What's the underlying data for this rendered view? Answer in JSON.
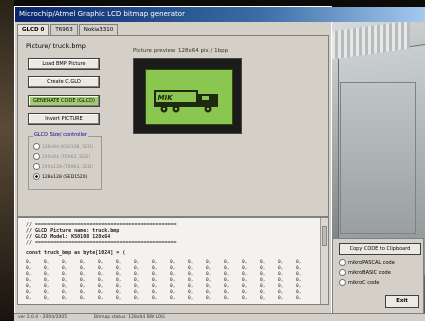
{
  "window": {
    "title": "Microchip/Atmel Graphic LCD bitmap generator"
  },
  "tabs": [
    {
      "label": "GLCD 0",
      "active": true
    },
    {
      "label": "T6963",
      "active": false
    },
    {
      "label": "Nokia3310",
      "active": false
    }
  ],
  "panel": {
    "section_title": "Picture/ truck.bmp",
    "buttons": [
      {
        "label": "Load BMP Picture",
        "style": "normal"
      },
      {
        "label": "Create C.GLD",
        "style": "normal"
      },
      {
        "label": "GENERATE CODE (GLCD)",
        "style": "green"
      },
      {
        "label": "Invert PICTURE",
        "style": "normal"
      }
    ],
    "controller": {
      "legend": "GLCD Size/ controller",
      "options": [
        {
          "label": "128x64 (KS0108, SED)",
          "selected": false
        },
        {
          "label": "240x64 (T6963, SED)",
          "selected": false
        },
        {
          "label": "240x128 (T6963, SED)",
          "selected": false
        },
        {
          "label": "128x128 (SED1520)",
          "selected": true
        }
      ]
    },
    "preview": {
      "label": "Picture preview",
      "resolution": "128x64 pix / 1bpp"
    }
  },
  "code": {
    "header_lines": [
      "// ===============================================",
      "// GLCD Picture name: truck.bmp",
      "// GLCD Model: KS0108 128x64",
      "// ==============================================="
    ],
    "array_decl": "const truck_bmp as byte[1024] = (",
    "rows": [
      [
        "0,",
        "0,",
        "0,",
        "0,",
        "0,",
        "0,",
        "0,",
        "0,",
        "0,",
        "0,",
        "0,",
        "0,",
        "0,",
        "0,",
        "0,",
        "0,"
      ],
      [
        "0,",
        "0,",
        "0,",
        "0,",
        "0,",
        "0,",
        "0,",
        "0,",
        "0,",
        "0,",
        "0,",
        "0,",
        "0,",
        "0,",
        "0,",
        "0,"
      ],
      [
        "0,",
        "0,",
        "0,",
        "0,",
        "0,",
        "0,",
        "0,",
        "0,",
        "0,",
        "0,",
        "0,",
        "0,",
        "0,",
        "0,",
        "0,",
        "0,"
      ],
      [
        "0,",
        "0,",
        "0,",
        "0,",
        "0,",
        "0,",
        "0,",
        "0,",
        "0,",
        "0,",
        "0,",
        "0,",
        "0,",
        "0,",
        "0,",
        "0,"
      ],
      [
        "0,",
        "0,",
        "0,",
        "0,",
        "0,",
        "0,",
        "0,",
        "0,",
        "0,",
        "0,",
        "0,",
        "0,",
        "0,",
        "0,",
        "0,",
        "0,"
      ],
      [
        "0,",
        "0,",
        "0,",
        "0,",
        "0,",
        "0,",
        "0,",
        "0,",
        "0,",
        "0,",
        "0,",
        "0,",
        "0,",
        "0,",
        "0,",
        "0,"
      ],
      [
        "0,",
        "0,",
        "0,",
        "0,",
        "0,",
        "0,",
        "0,",
        "0,",
        "0,",
        "0,",
        "0,",
        "0,",
        "0,",
        "0,",
        "0,",
        "0,"
      ]
    ]
  },
  "right_panel": {
    "copy_button": "Copy CODE to Clipboard",
    "output_options": [
      {
        "label": "mikroPASCAL code",
        "selected": false
      },
      {
        "label": "mikroBASIC code",
        "selected": false
      },
      {
        "label": "mikroC code",
        "selected": false
      }
    ],
    "exit_button": "Exit"
  },
  "status": {
    "left": "ver 2.0.4 - 2004/2005",
    "right": "Bitmap status: 128x64 BW LOG"
  },
  "colors": {
    "lcd_green": "#8bc650",
    "titlebar": "#0a246a",
    "accent_button": "#9fd06b"
  }
}
